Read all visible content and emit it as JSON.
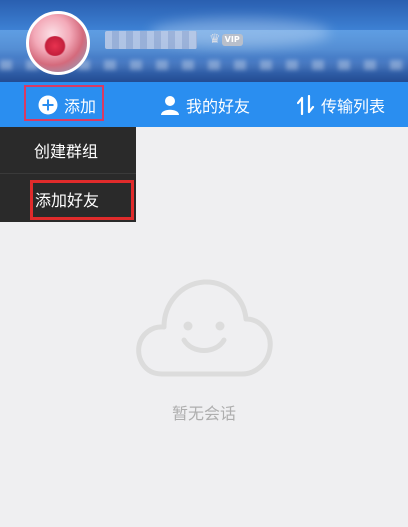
{
  "profile": {
    "avatar_icon": "avatar-image",
    "vip_label": "VIP"
  },
  "nav": {
    "add_label": "添加",
    "friends_label": "我的好友",
    "transfer_label": "传输列表"
  },
  "dropdown": {
    "items": [
      {
        "label": "创建群组"
      },
      {
        "label": "添加好友"
      }
    ]
  },
  "empty_state": {
    "icon": "smiling-cloud-icon",
    "message": "暂无会话"
  },
  "colors": {
    "nav_bg": "#2a8ef0",
    "menu_bg": "#2a2a2a",
    "page_bg": "#efeff1",
    "highlight_pink": "#d93a63",
    "highlight_red": "#e02b2b"
  }
}
